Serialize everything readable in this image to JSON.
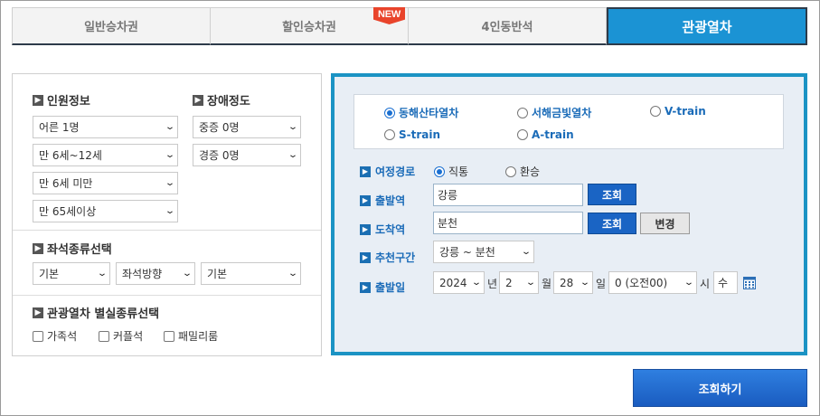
{
  "tabs": [
    {
      "label": "일반승차권",
      "active": false
    },
    {
      "label": "할인승차권",
      "active": false,
      "badge": "NEW"
    },
    {
      "label": "4인동반석",
      "active": false
    },
    {
      "label": "관광열차",
      "active": true
    }
  ],
  "passenger": {
    "title": "인원정보",
    "adult": "어른 1명",
    "child": "만 6세~12세",
    "infant": "만 6세 미만",
    "senior": "만 65세이상"
  },
  "disability": {
    "title": "장애정도",
    "severe": "중증 0명",
    "mild": "경증 0명"
  },
  "seat_type": {
    "title": "좌석종류선택",
    "type": "기본",
    "direction": "좌석방향",
    "position": "기본"
  },
  "special_seat": {
    "title": "관광열차 별실종류선택",
    "options": [
      "가족석",
      "커플석",
      "패밀리룸"
    ]
  },
  "trains": [
    {
      "label": "동해산타열차",
      "selected": true
    },
    {
      "label": "서해금빛열차",
      "selected": false
    },
    {
      "label": "V-train",
      "selected": false
    },
    {
      "label": "S-train",
      "selected": false
    },
    {
      "label": "A-train",
      "selected": false
    }
  ],
  "route": {
    "label": "여정경로",
    "options": [
      "직통",
      "환승"
    ],
    "selected": "직통"
  },
  "departure": {
    "label": "출발역",
    "value": "강릉",
    "button": "조회"
  },
  "arrival": {
    "label": "도착역",
    "value": "분천",
    "button": "조회",
    "swap_button": "변경"
  },
  "recommended": {
    "label": "추천구간",
    "value": "강릉 ~ 분천"
  },
  "date": {
    "label": "출발일",
    "year": "2024",
    "year_unit": "년",
    "month": "2",
    "month_unit": "월",
    "day": "28",
    "day_unit": "일",
    "hour": "0 (오전00)",
    "hour_unit": "시",
    "weekday": "수"
  },
  "search_button": "조회하기"
}
